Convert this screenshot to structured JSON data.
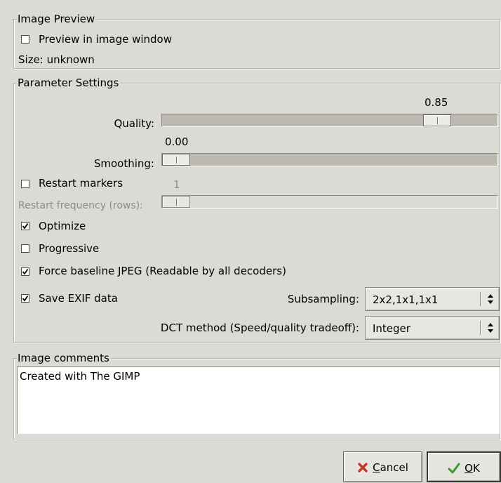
{
  "image_preview": {
    "title": "Image Preview",
    "preview_label": "Preview in image window",
    "preview_checked": false,
    "size_text": "Size: unknown"
  },
  "parameter_settings": {
    "title": "Parameter Settings",
    "quality": {
      "label": "Quality:",
      "value_text": "0.85",
      "value": 0.85
    },
    "smoothing": {
      "label": "Smoothing:",
      "value_text": "0.00",
      "value": 0.0
    },
    "restart_markers": {
      "label": "Restart markers",
      "checked": false
    },
    "restart_frequency": {
      "label": "Restart frequency (rows):",
      "value_text": "1",
      "value": 1
    },
    "optimize": {
      "label": "Optimize",
      "checked": true
    },
    "progressive": {
      "label": "Progressive",
      "checked": false
    },
    "force_baseline": {
      "label": "Force baseline JPEG (Readable by all decoders)",
      "checked": true
    },
    "save_exif": {
      "label": "Save EXIF data",
      "checked": true
    },
    "subsampling": {
      "label": "Subsampling:",
      "value": "2x2,1x1,1x1"
    },
    "dct_method": {
      "label": "DCT method (Speed/quality tradeoff):",
      "value": "Integer"
    }
  },
  "image_comments": {
    "title": "Image comments",
    "text": "Created with The GIMP"
  },
  "buttons": {
    "cancel_mnemonic": "C",
    "cancel_rest": "ancel",
    "ok_mnemonic": "O",
    "ok_rest": "K"
  },
  "colors": {
    "background": "#dcdad5",
    "cancel_icon": "#c0392b",
    "ok_icon": "#3a9a2a"
  }
}
